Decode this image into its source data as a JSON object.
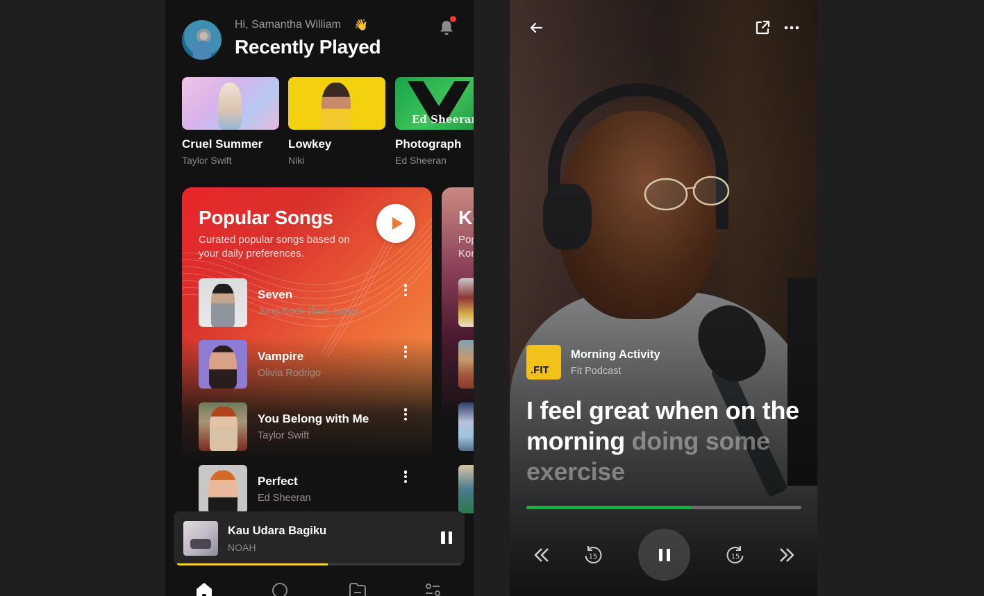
{
  "home": {
    "greeting": "Hi, Samantha William",
    "greeting_emoji": "👋",
    "section_title": "Recently Played",
    "notification_badge_color": "#f03a3a",
    "recently_played": [
      {
        "title": "Cruel Summer",
        "artist": "Taylor Swift"
      },
      {
        "title": "Lowkey",
        "artist": "Niki"
      },
      {
        "title": "Photograph",
        "artist": "Ed Sheeran",
        "art_text": "Ed Sheeran"
      }
    ],
    "playlists": [
      {
        "title": "Popular Songs",
        "subtitle": "Curated popular songs based on your daily preferences.",
        "songs": [
          {
            "title": "Seven",
            "artist": "Jung Kook (feat. Latto)"
          },
          {
            "title": "Vampire",
            "artist": "Olivia Rodrigo"
          },
          {
            "title": "You Belong with Me",
            "artist": "Taylor Swift"
          },
          {
            "title": "Perfect",
            "artist": "Ed Sheeran"
          }
        ]
      },
      {
        "title": "K-",
        "subtitle_line1": "Pop",
        "subtitle_line2": "Kor"
      }
    ],
    "now_playing": {
      "title": "Kau Udara Bagiku",
      "artist": "NOAH",
      "progress_percent": 53,
      "progress_color": "#f4d33a"
    },
    "tabs": [
      "home-icon",
      "search-icon",
      "library-icon",
      "settings-icon"
    ],
    "active_tab": "home"
  },
  "podcast": {
    "logo_text": ".FIT",
    "logo_color": "#f2c21b",
    "episode_title": "Morning Activity",
    "show_name": "Fit Podcast",
    "lyrics_spoken": "I feel great when on the morning",
    "lyrics_upcoming": "doing some exercise",
    "progress_percent": 60,
    "progress_color": "#12b544",
    "skip_seconds": "15"
  }
}
